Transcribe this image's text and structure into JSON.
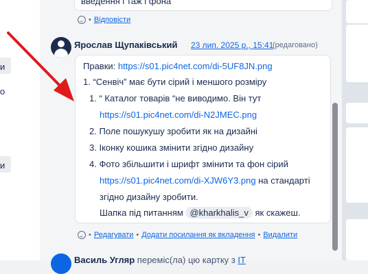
{
  "left_panel": {
    "labels": [
      "и",
      "о",
      "и"
    ]
  },
  "previous_comment": {
    "text_fragment": "введення і таж і фона",
    "reply_label": "Відповісти"
  },
  "comment": {
    "author": "Ярослав Щупаківський",
    "timestamp": "23 лип. 2025 р., 15:41",
    "edited_label": "(редаговано)",
    "intro_label": "Правки:",
    "intro_link": "https://s01.pic4net.com/di-5UF8JN.png",
    "item1_text": "1. “Сенвіч” має бути сірий і меншого розміру",
    "sub_items": {
      "n1": "1.",
      "i1_text": "“ Каталог товарів “не виводимо. Він тут",
      "i1_link": "https://s01.pic4net.com/di-N2JMEC.png",
      "n2": "2.",
      "i2_text": "Поле пошукушу зробити як на дизайні",
      "n3": "3.",
      "i3_text": "Іконку кошика змінити згідно дизайну",
      "n4": "4.",
      "i4_text": "Фото збільшити і шрифт змінити та фон сірий",
      "i4_link": "https://s01.pic4net.com/di-XJW6Y3.png",
      "i4_suffix": "на стандарті",
      "i4_cont": "згідно дизайну зробити.",
      "i4_extra_prefix": "Шапка під питанням",
      "mention": "@kharkhalis_v",
      "i4_extra_suffix": "як скажеш."
    },
    "actions": {
      "edit": "Редагувати",
      "add_attachment_link": "Додати посилання як вкладення",
      "delete": "Видалити"
    }
  },
  "next_activity": {
    "author": "Василь Угляр",
    "action": "переміс(ла) цю картку з",
    "target": "IT"
  },
  "colors": {
    "accent": "#0c66e4",
    "arrow": "#e01b1b"
  }
}
